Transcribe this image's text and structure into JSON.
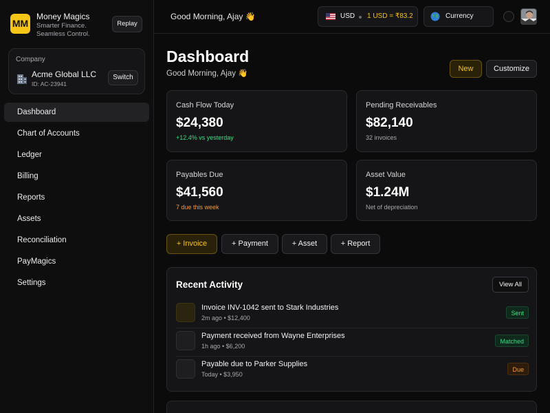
{
  "brand": {
    "logo_text": "MM",
    "name": "Money Magics",
    "tagline": "Smarter Finance. Seamless Control.",
    "replay_label": "Replay"
  },
  "company": {
    "label": "Company",
    "name": "Acme Global LLC",
    "id": "ID: AC-23941",
    "switch_label": "Switch",
    "icon": "building-icon"
  },
  "sidebar": {
    "items": [
      {
        "label": "Dashboard",
        "active": true
      },
      {
        "label": "Chart of Accounts"
      },
      {
        "label": "Ledger"
      },
      {
        "label": "Billing"
      },
      {
        "label": "Reports"
      },
      {
        "label": "Assets"
      },
      {
        "label": "Reconciliation"
      },
      {
        "label": "PayMagics"
      },
      {
        "label": "Settings"
      }
    ]
  },
  "topbar": {
    "greeting": "Good Morning, Ajay 👋",
    "currency_code": "USD",
    "rate": "1 USD = ₹83.2",
    "currency_label": "Currency"
  },
  "header": {
    "title": "Dashboard",
    "subtitle": "Good Morning, Ajay 👋",
    "new_label": "New",
    "customize_label": "Customize"
  },
  "stats": [
    {
      "label": "Cash Flow Today",
      "value": "$24,380",
      "note": "+12.4% vs yesterday",
      "tone": "green"
    },
    {
      "label": "Pending Receivables",
      "value": "$82,140",
      "note": "32 invoices",
      "tone": "muted"
    },
    {
      "label": "Payables Due",
      "value": "$41,560",
      "note": "7 due this week",
      "tone": "orange"
    },
    {
      "label": "Asset Value",
      "value": "$1.24M",
      "note": "Net of depreciation",
      "tone": "muted"
    }
  ],
  "quick_actions": [
    "+ Invoice",
    "+ Payment",
    "+ Asset",
    "+ Report"
  ],
  "activity": {
    "title": "Recent Activity",
    "view_all_label": "View All",
    "items": [
      {
        "title": "Invoice INV-1042 sent to Stark Industries",
        "meta": "2m ago • $12,400",
        "status": "Sent"
      },
      {
        "title": "Payment received from Wayne Enterprises",
        "meta": "1h ago • $6,200",
        "status": "Matched"
      },
      {
        "title": "Payable due to Parker Supplies",
        "meta": "Today • $3,950",
        "status": "Due"
      }
    ]
  },
  "colors": {
    "accent": "#f5c518",
    "background": "#0b0b0c",
    "positive": "#3ddc84",
    "warning": "#f29b38"
  }
}
